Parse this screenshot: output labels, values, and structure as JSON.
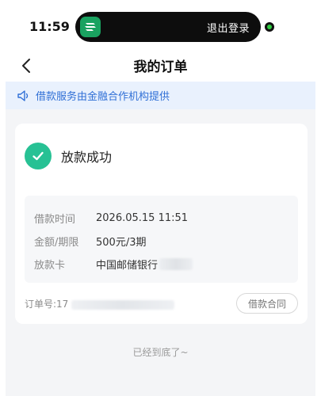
{
  "status_bar": {
    "time": "11:59",
    "island_app_icon": "post-bank-icon",
    "island_text": "退出登录"
  },
  "nav": {
    "back_icon": "chevron-left-icon",
    "title": "我的订单"
  },
  "notice": {
    "icon": "speaker-icon",
    "text": "借款服务由金融合作机构提供"
  },
  "order": {
    "status_icon": "check-circle-icon",
    "status": "放款成功",
    "details": [
      {
        "label": "借款时间",
        "value": "2026.05.15 11:51"
      },
      {
        "label": "金额/期限",
        "value": "500元/3期"
      },
      {
        "label": "放款卡",
        "value": "中国邮储银行"
      }
    ],
    "order_no_label": "订单号:17",
    "contract_button": "借款合同"
  },
  "footer": {
    "end_tip": "已经到底了~"
  },
  "colors": {
    "accent_green": "#27c194",
    "notice_blue": "#2f6fd6",
    "notice_bg": "#e9f1fd",
    "page_bg": "#f4f5f7"
  }
}
